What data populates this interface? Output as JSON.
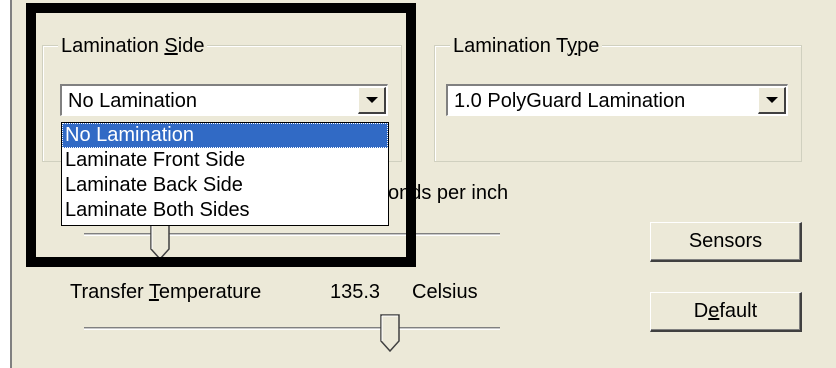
{
  "lamination_side": {
    "legend_pre": "Lamination ",
    "legend_key": "S",
    "legend_post": "ide",
    "selected": "No Lamination",
    "options": [
      "No Lamination",
      "Laminate Front Side",
      "Laminate Back Side",
      "Laminate Both Sides"
    ]
  },
  "lamination_type": {
    "legend_pre": "Lamination T",
    "legend_key": "y",
    "legend_post": "pe",
    "selected": "1.0 PolyGuard Lamination"
  },
  "speed": {
    "unit_partial": "onds per inch",
    "level": 0.17
  },
  "transfer_temperature": {
    "label_pre": "Transfer ",
    "label_key": "T",
    "label_post": "emperature",
    "value": "135.3",
    "unit": "Celsius",
    "level": 0.76
  },
  "buttons": {
    "sensors": "Sensors",
    "default_pre": "D",
    "default_key": "e",
    "default_post": "fault"
  },
  "colors": {
    "dialog_bg": "#ece9d8",
    "selection": "#316ac5",
    "highlight_frame": "#000000"
  }
}
